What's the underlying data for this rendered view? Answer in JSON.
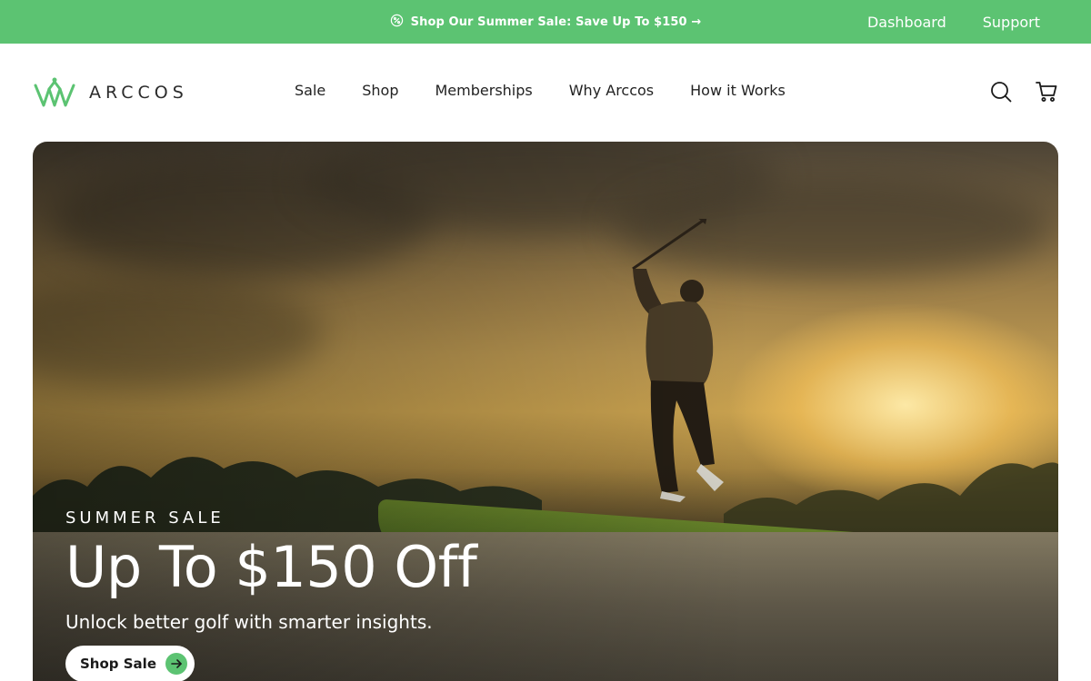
{
  "promo": {
    "message": "Shop Our Summer Sale: Save Up To $150 →",
    "icon": "sale-badge-icon",
    "links": [
      "Dashboard",
      "Support"
    ],
    "background": "#5cc372"
  },
  "header": {
    "logo_text": "ARCCOS",
    "nav": [
      "Sale",
      "Shop",
      "Memberships",
      "Why Arccos",
      "How it Works"
    ],
    "icons": [
      "search-icon",
      "cart-icon"
    ]
  },
  "hero": {
    "eyebrow": "SUMMER SALE",
    "headline": "Up To $150 Off",
    "subhead": "Unlock better golf with smarter insights.",
    "cta_label": "Shop Sale",
    "accent": "#5cc372"
  }
}
